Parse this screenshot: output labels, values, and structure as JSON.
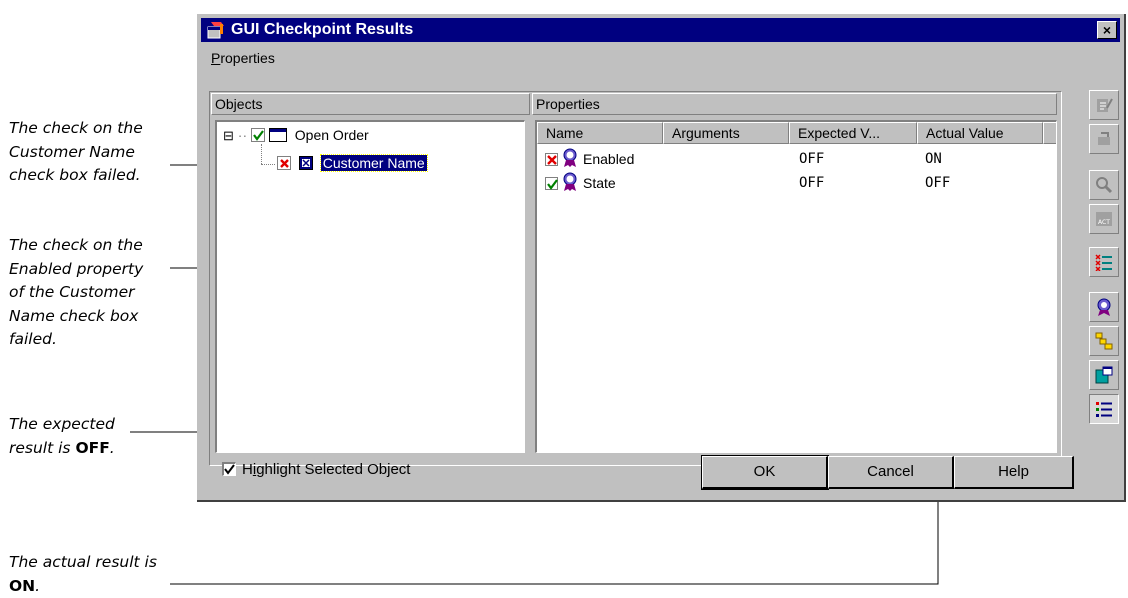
{
  "annotations": {
    "a1_lines": [
      "The check on the",
      "Customer Name",
      "check box failed."
    ],
    "a2_lines": [
      "The check on the",
      "Enabled property",
      "of the Customer",
      "Name check box",
      "failed."
    ],
    "a3_line1": "The expected",
    "a3_prefix": "result is ",
    "a3_bold": "OFF",
    "a3_suffix": ".",
    "a4_line1": "The actual result is",
    "a4_bold": "ON",
    "a4_suffix": "."
  },
  "window": {
    "title": "GUI Checkpoint Results",
    "close_label": "×",
    "menu": [
      {
        "mnemonic": "P",
        "rest": "roperties"
      }
    ]
  },
  "objects_panel": {
    "header": "Objects",
    "tree": [
      {
        "label": "Open Order",
        "status": "passed",
        "icon": "window-icon",
        "expander": "⊟"
      },
      {
        "label": "Customer Name",
        "status": "failed",
        "icon": "checkbox-object-icon",
        "selected": true
      }
    ]
  },
  "properties_panel": {
    "header": "Properties",
    "columns": [
      "Name",
      "Arguments",
      "Expected V...",
      "Actual Value"
    ],
    "rows": [
      {
        "status": "failed",
        "name": "Enabled",
        "arguments": "",
        "expected": "OFF",
        "actual": "ON"
      },
      {
        "status": "passed",
        "name": "State",
        "arguments": "",
        "expected": "OFF",
        "actual": "OFF"
      }
    ]
  },
  "footer": {
    "highlight_mnemonic": "i",
    "highlight_pre": "H",
    "highlight_post": "ghlight Selected Object",
    "highlight_checked": true,
    "ok": "OK",
    "cancel": "Cancel",
    "help": "Help"
  },
  "toolbar": [
    {
      "icon": "edit-expected-icon",
      "enabled": false
    },
    {
      "icon": "update-expected-icon",
      "enabled": false
    },
    {
      "icon": "compare-icon",
      "enabled": false
    },
    {
      "icon": "edit-properties-icon",
      "enabled": false
    },
    {
      "icon": "show-failures-icon",
      "enabled": true
    },
    {
      "icon": "checkpoint-property-icon",
      "enabled": true
    },
    {
      "icon": "hierarchy-icon",
      "enabled": true
    },
    {
      "icon": "window-objects-icon",
      "enabled": true
    },
    {
      "icon": "list-view-icon",
      "enabled": true,
      "pressed": true
    }
  ],
  "colors": {
    "title_bg": "#000080",
    "face": "#c0c0c0",
    "fail": "#e00000",
    "pass": "#008000"
  }
}
